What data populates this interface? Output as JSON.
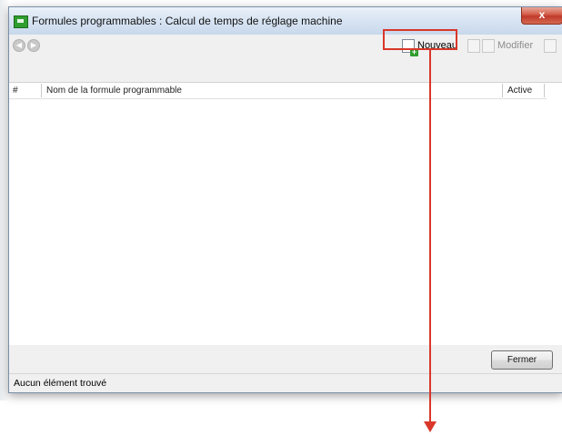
{
  "window": {
    "title": "Formules programmables : Calcul de temps de réglage machine",
    "close_label": "x"
  },
  "toolbar": {
    "back_icon": "back-arrow-icon",
    "forward_icon": "forward-arrow-icon",
    "nouveau_label": "Nouveau",
    "modifier_label": "Modifier"
  },
  "list": {
    "columns": [
      "#",
      "Nom de la formule programmable",
      "Active"
    ],
    "rows": []
  },
  "footer": {
    "fermer_label": "Fermer"
  },
  "status": {
    "text": "Aucun élément trouvé"
  },
  "annotation": {
    "color": "#d9372a"
  }
}
